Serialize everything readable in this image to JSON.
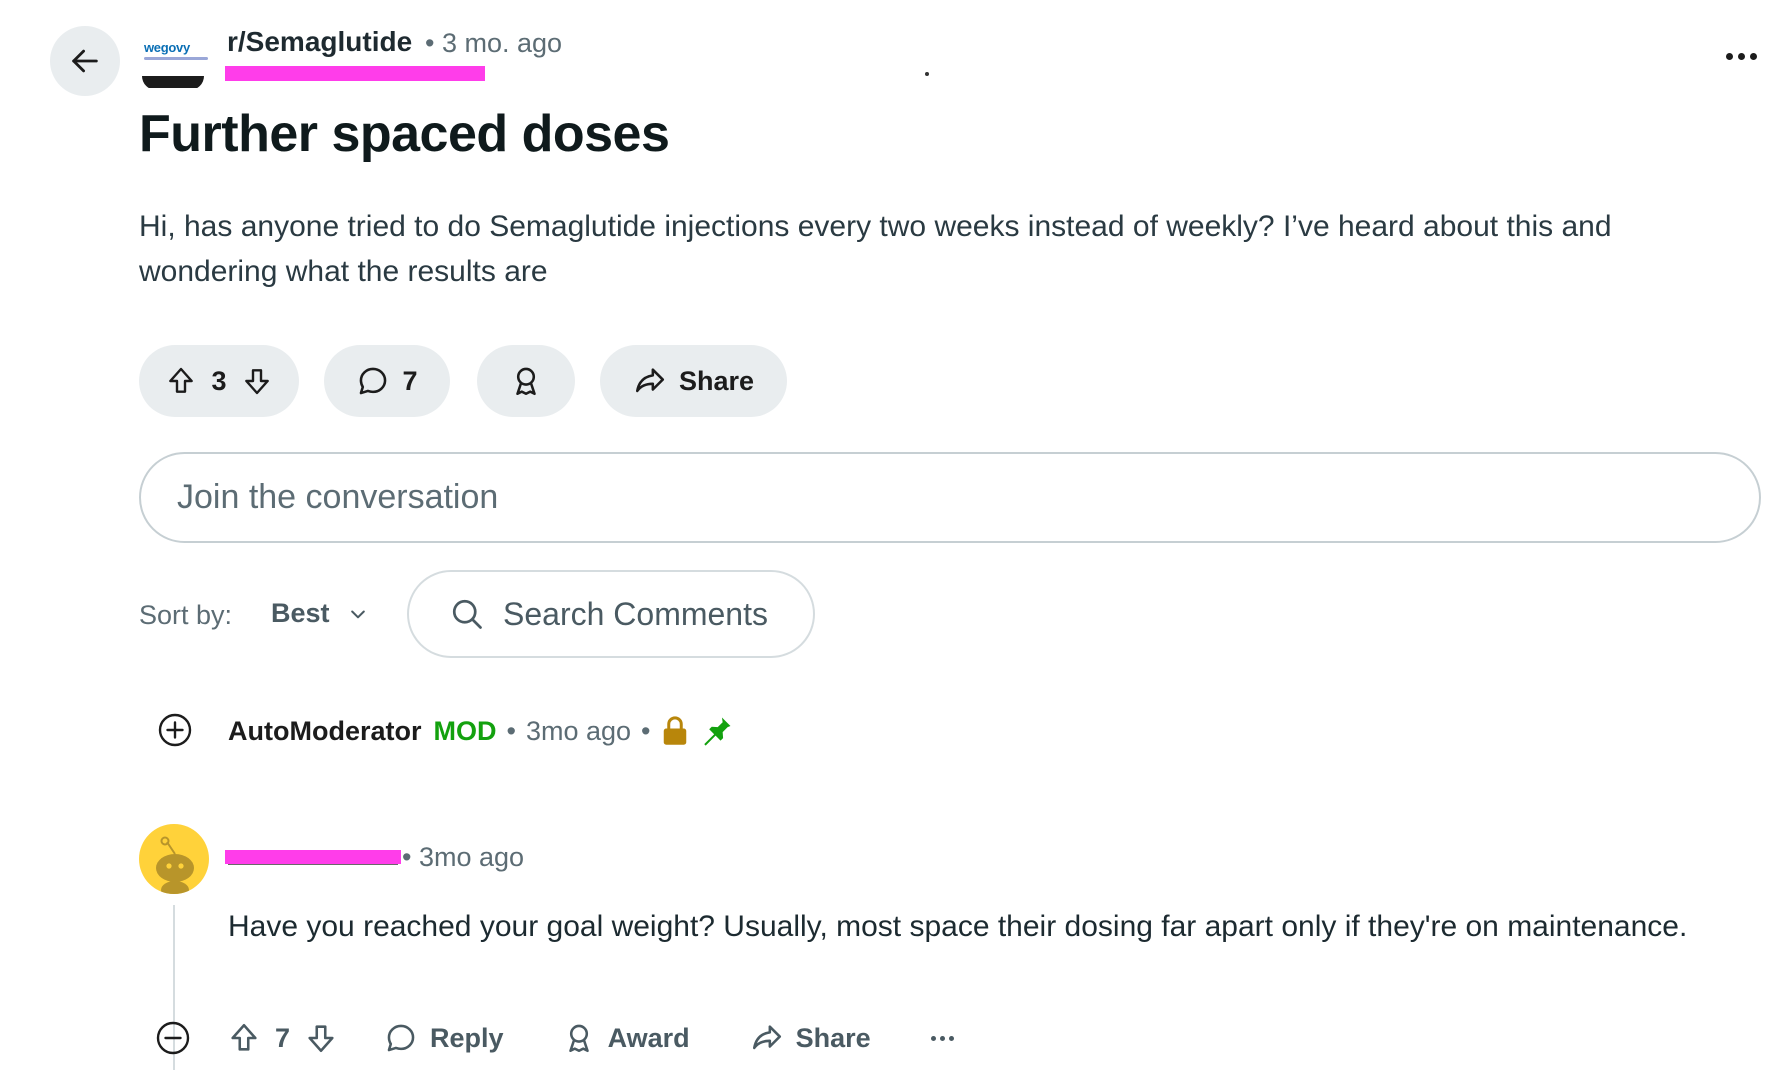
{
  "post": {
    "subreddit": "r/Semaglutide",
    "age": "• 3 mo. ago",
    "subreddit_logo_text": "wegovy",
    "title": "Further spaced doses",
    "body": "Hi, has anyone tried to do Semaglutide injections every two weeks instead of weekly? I’ve heard about this and wondering what the results are",
    "vote_count": "3",
    "comment_count": "7",
    "share_label": "Share"
  },
  "composer": {
    "placeholder": "Join the conversation"
  },
  "sort": {
    "label": "Sort by:",
    "value": "Best",
    "search_placeholder": "Search Comments"
  },
  "automod": {
    "author": "AutoModerator",
    "badge": "MOD",
    "sep1": "•",
    "time": "3mo ago",
    "sep2": "•"
  },
  "comment": {
    "meta": "• 3mo ago",
    "body": "Have you reached your goal weight? Usually, most space their dosing far apart only if they're on maintenance.",
    "vote_count": "7",
    "reply_label": "Reply",
    "award_label": "Award",
    "share_label": "Share"
  },
  "colors": {
    "mod_green": "#13a10e",
    "redaction": "#ff3dea",
    "pill_bg": "#e9edef",
    "lock": "#b8860b",
    "pin": "#13a10e",
    "avatar_bg": "#ffd23a"
  },
  "icons": [
    "back-arrow-icon",
    "more-icon",
    "upvote-icon",
    "downvote-icon",
    "comment-icon",
    "award-icon",
    "share-icon",
    "chevron-down-icon",
    "search-icon",
    "plus-circle-icon",
    "lock-icon",
    "pin-icon",
    "snoo-icon",
    "minus-circle-icon"
  ]
}
